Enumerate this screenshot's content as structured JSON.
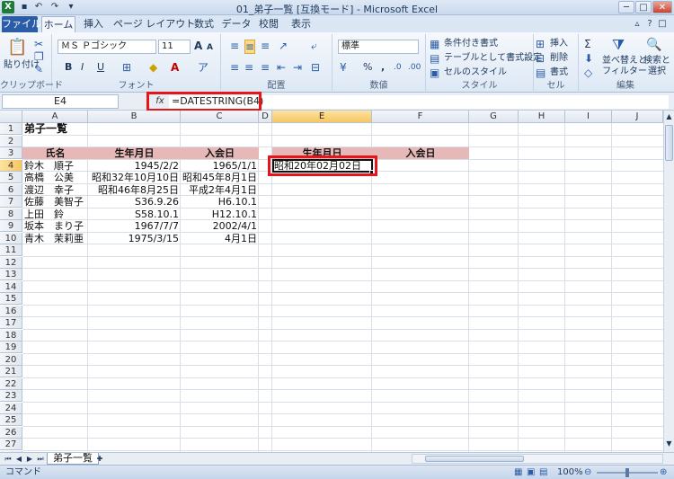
{
  "window": {
    "title": "01_弟子一覧 [互換モード] - Microsoft Excel",
    "app_icon": "X"
  },
  "ribbon": {
    "tabs": [
      "ファイル",
      "ホーム",
      "挿入",
      "ページ レイアウト",
      "数式",
      "データ",
      "校閲",
      "表示"
    ],
    "active_tab": "ホーム",
    "groups": {
      "clipboard": {
        "label": "クリップボード",
        "paste": "貼り付け"
      },
      "font": {
        "label": "フォント",
        "font_name": "ＭＳ Ｐゴシック",
        "font_size": "11",
        "bold": "B",
        "italic": "I",
        "underline": "U",
        "grow": "A",
        "shrink": "A"
      },
      "alignment": {
        "label": "配置"
      },
      "number": {
        "label": "数値",
        "format": "標準",
        "percent": "%",
        "comma": ","
      },
      "style": {
        "label": "スタイル",
        "conditional": "条件付き書式",
        "table": "テーブルとして書式設定",
        "cell_style": "セルのスタイル"
      },
      "cells": {
        "label": "セル",
        "insert": "挿入",
        "delete": "削除",
        "format": "書式"
      },
      "editing": {
        "label": "編集",
        "sort": "並べ替えと\nフィルター",
        "find": "検索と\n選択",
        "sigma": "Σ"
      }
    }
  },
  "formula_bar": {
    "name_box": "E4",
    "fx": "fx",
    "formula": "=DATESTRING(B4)"
  },
  "sheet": {
    "columns": [
      "A",
      "B",
      "C",
      "D",
      "E",
      "F",
      "G",
      "H",
      "I",
      "J"
    ],
    "selected_column": "E",
    "selected_row": "4",
    "rows": [
      "1",
      "2",
      "3",
      "4",
      "5",
      "6",
      "7",
      "8",
      "9",
      "10",
      "11",
      "12",
      "13",
      "14",
      "15",
      "16",
      "17",
      "18",
      "19",
      "20",
      "21",
      "22",
      "23",
      "24",
      "25",
      "26",
      "27",
      "28"
    ],
    "title": "弟子一覧",
    "headers": {
      "name": "氏名",
      "birth": "生年月日",
      "join": "入会日",
      "birth2": "生年月日",
      "join2": "入会日"
    },
    "records": [
      {
        "name": "鈴木　順子",
        "birth": "1945/2/2",
        "join": "1965/1/1"
      },
      {
        "name": "高橋　公美",
        "birth": "昭和32年10月10日",
        "join": "昭和45年8月1日"
      },
      {
        "name": "渡辺　幸子",
        "birth": "昭和46年8月25日",
        "join": "平成2年4月1日"
      },
      {
        "name": "佐藤　美智子",
        "birth": "S36.9.26",
        "join": "H6.10.1"
      },
      {
        "name": "上田　鈴",
        "birth": "S58.10.1",
        "join": "H12.10.1"
      },
      {
        "name": "坂本　まり子",
        "birth": "1967/7/7",
        "join": "2002/4/1"
      },
      {
        "name": "青木　茉莉亜",
        "birth": "1975/3/15",
        "join": "4月1日"
      }
    ],
    "e4_value": "昭和20年02月02日"
  },
  "sheet_tabs": {
    "active": "弟子一覧"
  },
  "status_bar": {
    "mode": "コマンド",
    "zoom": "100%"
  }
}
